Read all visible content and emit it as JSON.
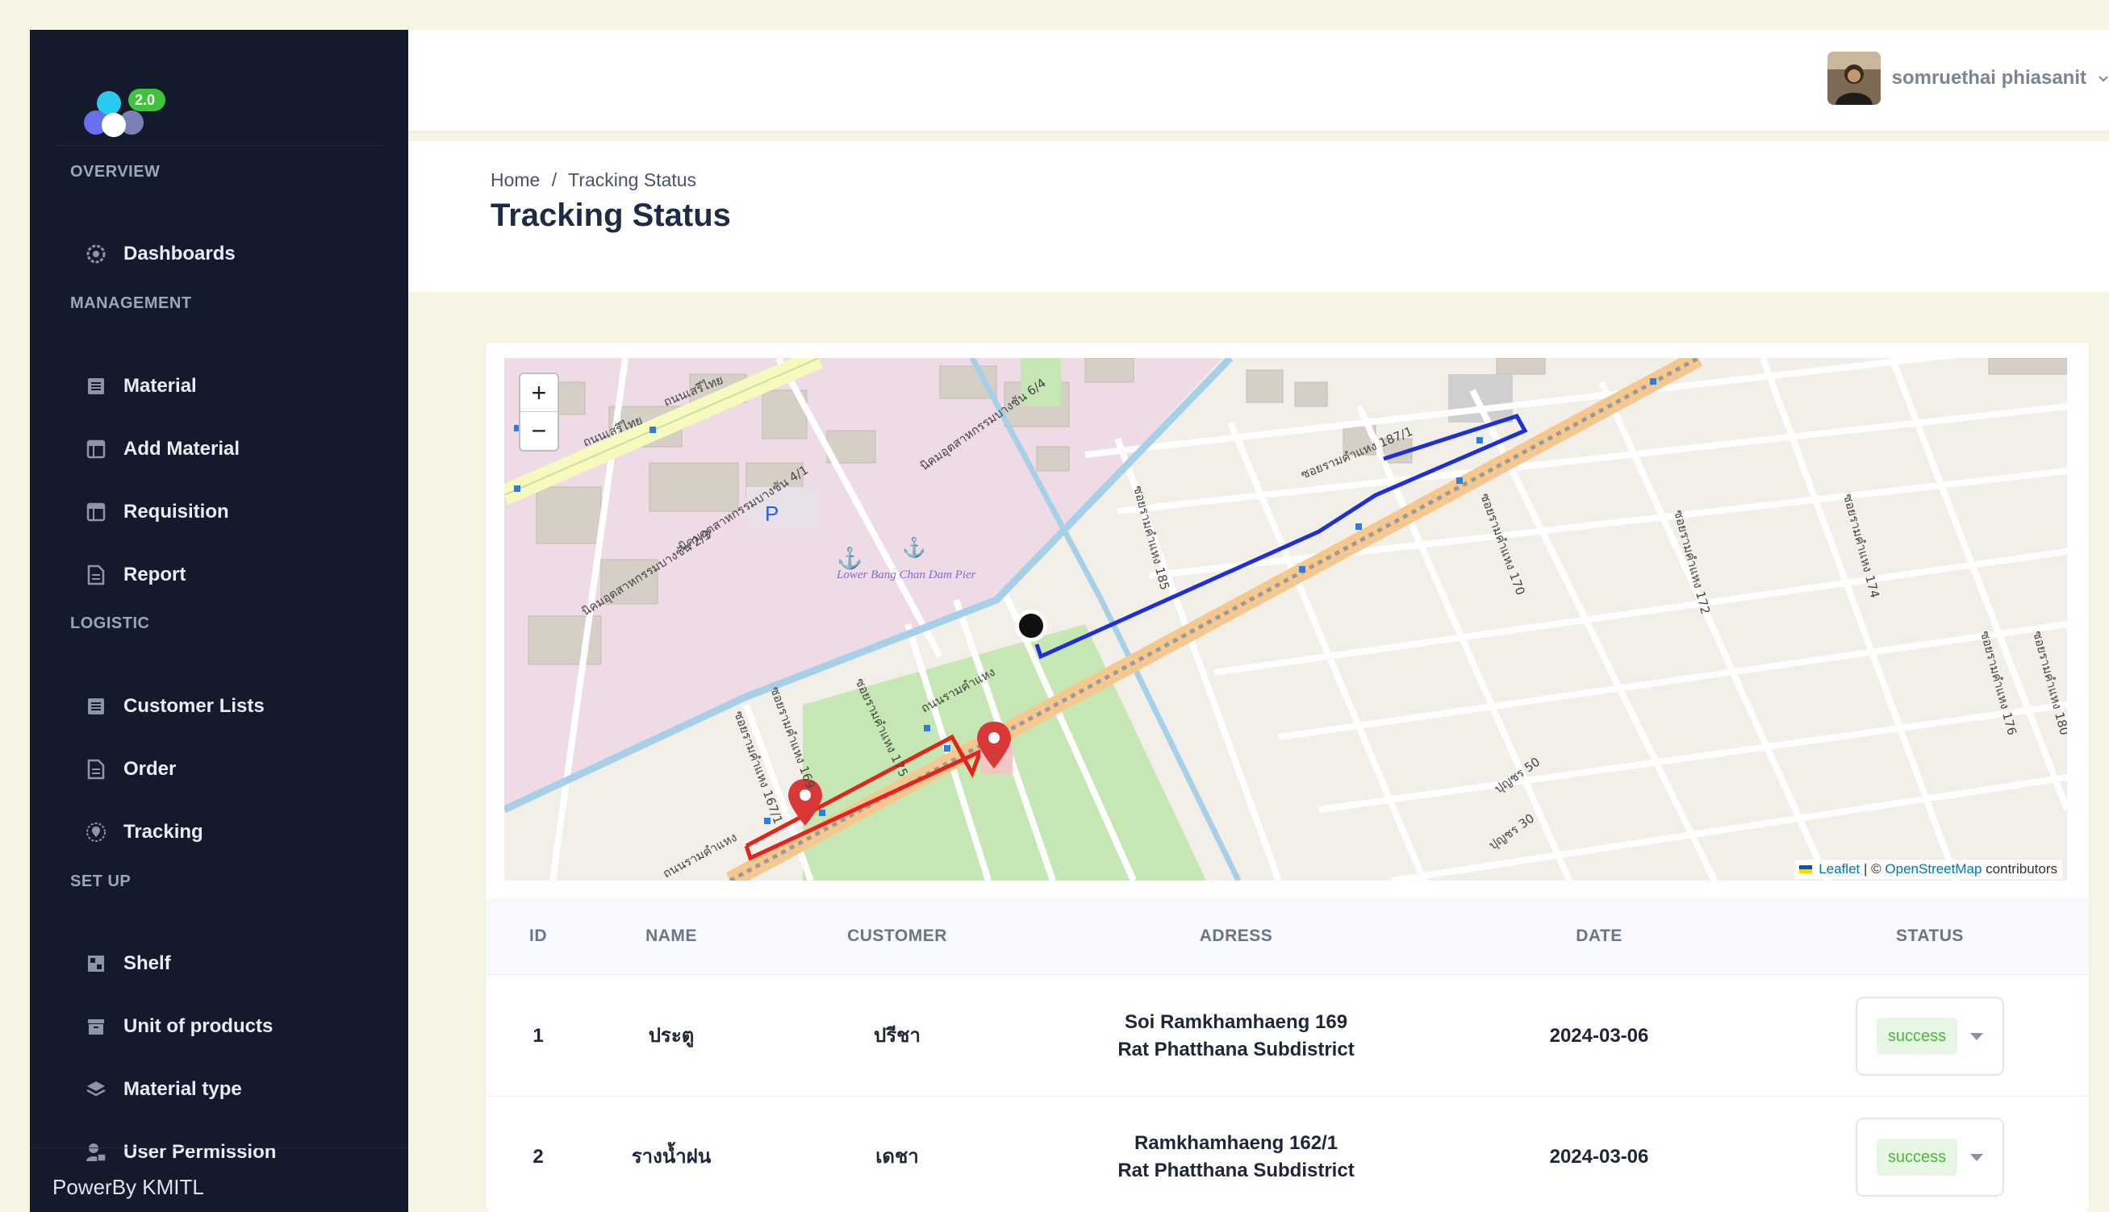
{
  "app": {
    "version_badge": "2.0"
  },
  "sidebar": {
    "sections": [
      {
        "title": "OVERVIEW",
        "items": [
          {
            "label": "Dashboards",
            "icon": "gauge-icon"
          }
        ]
      },
      {
        "title": "MANAGEMENT",
        "items": [
          {
            "label": "Material",
            "icon": "list-icon"
          },
          {
            "label": "Add Material",
            "icon": "table-icon"
          },
          {
            "label": "Requisition",
            "icon": "table-icon"
          },
          {
            "label": "Report",
            "icon": "document-icon"
          }
        ]
      },
      {
        "title": "LOGISTIC",
        "items": [
          {
            "label": "Customer Lists",
            "icon": "list-icon"
          },
          {
            "label": "Order",
            "icon": "document-icon"
          },
          {
            "label": "Tracking",
            "icon": "location-icon"
          }
        ]
      },
      {
        "title": "SET UP",
        "items": [
          {
            "label": "Shelf",
            "icon": "shelf-icon"
          },
          {
            "label": "Unit of products",
            "icon": "archive-icon"
          },
          {
            "label": "Material type",
            "icon": "layers-icon"
          },
          {
            "label": "User Permission",
            "icon": "user-lock-icon"
          }
        ]
      }
    ],
    "footer": "PowerBy KMITL"
  },
  "header": {
    "user_name": "somruethai phiasanit"
  },
  "breadcrumb": {
    "home": "Home",
    "separator": "/",
    "current": "Tracking Status"
  },
  "page_title": "Tracking Status",
  "map": {
    "zoom_in": "+",
    "zoom_out": "−",
    "labels": {
      "pier": "Lower Bang Chan Dam Pier",
      "parking": "P",
      "road_1": "ถนนเสรีไทย",
      "road_2": "ถนนรามคำแหง",
      "road_3": "นิคมอุตสาหกรรมบางชัน 6/4",
      "road_4": "ซอยรามคำแหง 187/1",
      "road_5": "ซอยรามคำแหง 170",
      "road_6": "ซอยรามคำแหง 172",
      "road_7": "ซอยรามคำแหง 174",
      "road_8": "ซอยรามคำแหง 176",
      "road_9": "ซอยรามคำแหง 180",
      "road_10": "ซอยรามคำแหง 185",
      "road_11": "ซอยรามคำแหง 175",
      "road_12": "ซอยรามคำแหง 169",
      "road_13": "ซอยรามคำแหง 167/1",
      "road_14": "นิคมอุตสาหกรรมบางชัน 4/1",
      "road_15": "นิคมอุตสาหกรรมบางชัน 2/3",
      "road_16": "ปุญชร 50",
      "road_17": "ปุญชร 30"
    },
    "attribution": {
      "leaflet": "Leaflet",
      "sep": "|",
      "copy": "©",
      "osm": "OpenStreetMap",
      "suffix": "contributors"
    }
  },
  "table": {
    "columns": [
      "ID",
      "NAME",
      "CUSTOMER",
      "ADRESS",
      "DATE",
      "STATUS"
    ],
    "rows": [
      {
        "id": "1",
        "name": "ประตู",
        "customer": "ปรีชา",
        "address_1": "Soi Ramkhamhaeng 169",
        "address_2": "Rat Phatthana Subdistrict",
        "date": "2024-03-06",
        "status": "success"
      },
      {
        "id": "2",
        "name": "รางน้ำฝน",
        "customer": "เดชา",
        "address_1": "Ramkhamhaeng 162/1",
        "address_2": "Rat Phatthana Subdistrict",
        "date": "2024-03-06",
        "status": "success"
      }
    ]
  },
  "colors": {
    "sidebar": "#121a2c",
    "accent_green": "#4cb83a",
    "route_blue": "#1f2fd6",
    "route_red": "#e3231c"
  }
}
